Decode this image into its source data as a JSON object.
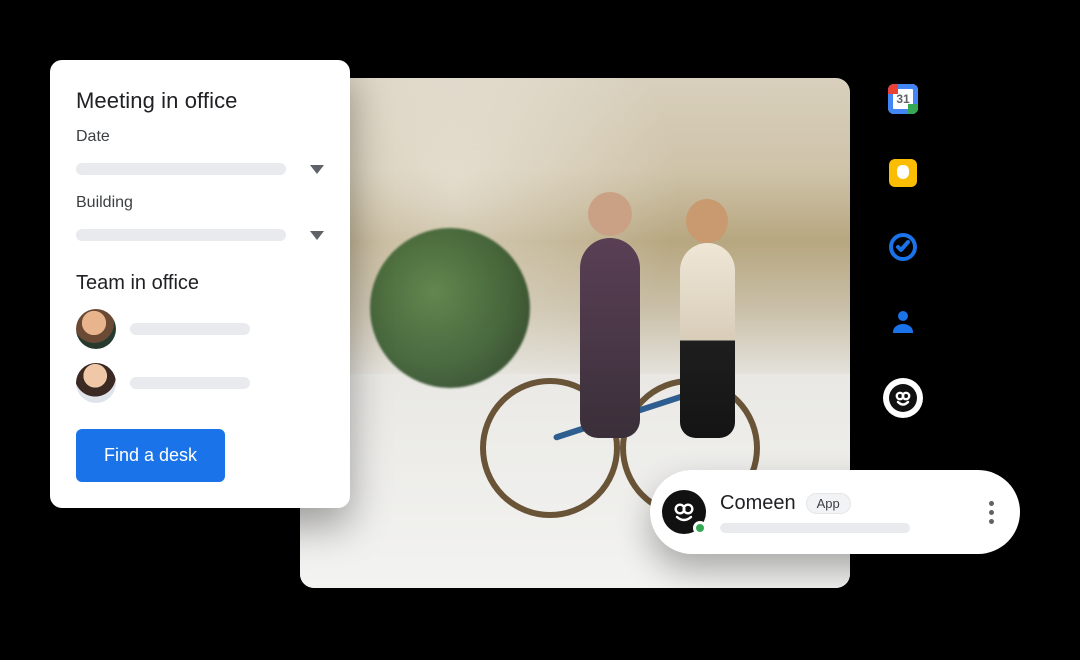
{
  "card": {
    "title": "Meeting in office",
    "date_label": "Date",
    "building_label": "Building",
    "team_heading": "Team in office",
    "cta_label": "Find a desk"
  },
  "side_panel": {
    "calendar_day": "31",
    "icons": {
      "calendar": "calendar-icon",
      "keep": "keep-icon",
      "tasks": "tasks-icon",
      "contacts": "contacts-icon",
      "comeen": "comeen-icon"
    }
  },
  "chat_chip": {
    "app_name": "Comeen",
    "badge_label": "App"
  },
  "colors": {
    "primary": "#1a73e8",
    "placeholder": "#e8eaed",
    "text": "#202124",
    "presence_online": "#34a853"
  }
}
